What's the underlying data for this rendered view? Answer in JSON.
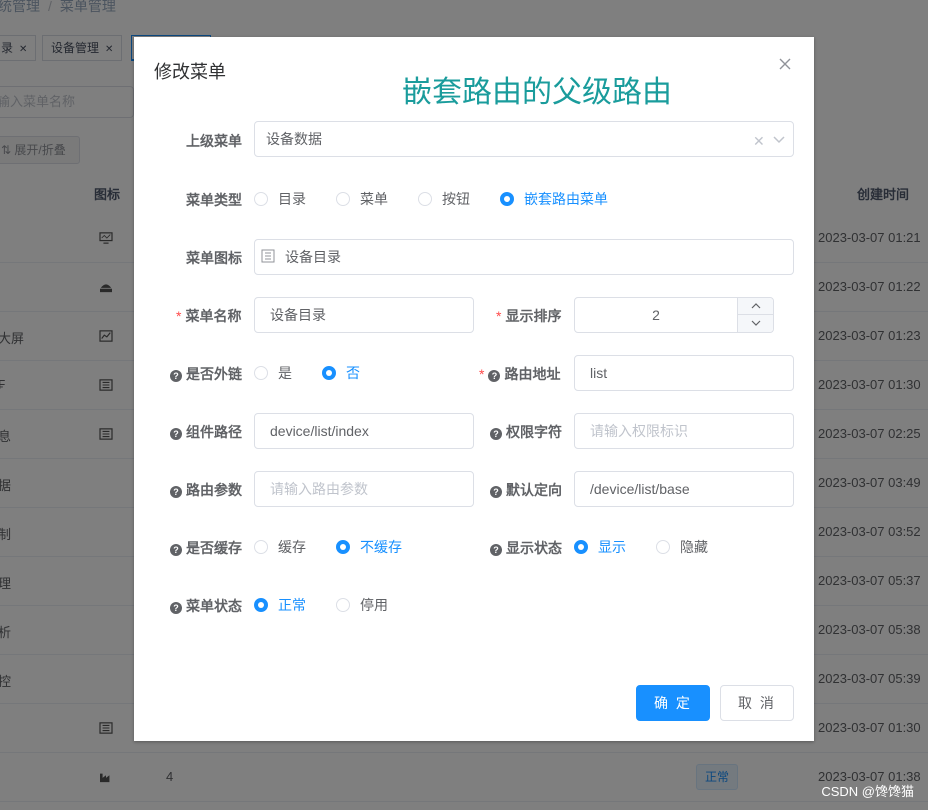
{
  "background": {
    "breadcrumb": {
      "prefix": "统管理",
      "separator": "/",
      "current": "菜单管理"
    },
    "tags": [
      {
        "label": "录"
      },
      {
        "label": "设备管理"
      }
    ],
    "search_placeholder": "输入菜单名称",
    "expand_button": "展开/折叠",
    "columns": {
      "icon": "图标",
      "created": "创建时间"
    },
    "rows": [
      {
        "name": "",
        "time": "2023-03-07 01:21",
        "icon": "monitor-icon",
        "num": "",
        "status": ""
      },
      {
        "name": "",
        "time": "2023-03-07 01:22",
        "icon": "server-icon",
        "num": "",
        "status": ""
      },
      {
        "name": "大屏",
        "time": "2023-03-07 01:23",
        "icon": "chart-icon",
        "num": "",
        "status": ""
      },
      {
        "name": "₣",
        "time": "2023-03-07 01:30",
        "icon": "list-icon",
        "num": "",
        "status": ""
      },
      {
        "name": "息",
        "time": "2023-03-07 02:25",
        "icon": "list-icon",
        "num": "",
        "status": ""
      },
      {
        "name": "据",
        "time": "2023-03-07 03:49",
        "icon": "",
        "num": "",
        "status": ""
      },
      {
        "name": "制",
        "time": "2023-03-07 03:52",
        "icon": "",
        "num": "",
        "status": ""
      },
      {
        "name": "理",
        "time": "2023-03-07 05:37",
        "icon": "",
        "num": "",
        "status": ""
      },
      {
        "name": "析",
        "time": "2023-03-07 05:38",
        "icon": "",
        "num": "",
        "status": ""
      },
      {
        "name": "控",
        "time": "2023-03-07 05:39",
        "icon": "",
        "num": "",
        "status": ""
      },
      {
        "name": "",
        "time": "2023-03-07 01:30",
        "icon": "list-icon",
        "num": "",
        "status": ""
      },
      {
        "name": "",
        "time": "2023-03-07 01:38",
        "icon": "factory-icon",
        "num": "4",
        "status": "正常"
      }
    ],
    "watermark": "CSDN @馋馋猫"
  },
  "dialog": {
    "title": "修改菜单",
    "annotation": "嵌套路由的父级路由",
    "parent_menu": {
      "label": "上级菜单",
      "value": "设备数据"
    },
    "menu_type": {
      "label": "菜单类型",
      "options": [
        "目录",
        "菜单",
        "按钮",
        "嵌套路由菜单"
      ],
      "selected": 3
    },
    "menu_icon": {
      "label": "菜单图标",
      "value": "设备目录"
    },
    "menu_name": {
      "label": "菜单名称",
      "value": "设备目录"
    },
    "sort_order": {
      "label": "显示排序",
      "value": "2"
    },
    "is_external": {
      "label": "是否外链",
      "options": [
        "是",
        "否"
      ],
      "selected": 1
    },
    "route_path": {
      "label": "路由地址",
      "value": "list"
    },
    "component_path": {
      "label": "组件路径",
      "value": "device/list/index"
    },
    "permission": {
      "label": "权限字符",
      "placeholder": "请输入权限标识"
    },
    "route_params": {
      "label": "路由参数",
      "placeholder": "请输入路由参数"
    },
    "default_redirect": {
      "label": "默认定向",
      "value": "/device/list/base"
    },
    "is_cache": {
      "label": "是否缓存",
      "options": [
        "缓存",
        "不缓存"
      ],
      "selected": 1
    },
    "visible": {
      "label": "显示状态",
      "options": [
        "显示",
        "隐藏"
      ],
      "selected": 0
    },
    "menu_status": {
      "label": "菜单状态",
      "options": [
        "正常",
        "停用"
      ],
      "selected": 0
    },
    "confirm": "确 定",
    "cancel": "取 消"
  },
  "colors": {
    "primary": "#1890ff",
    "annotation": "#1a9c9c",
    "required": "#ff4949"
  }
}
